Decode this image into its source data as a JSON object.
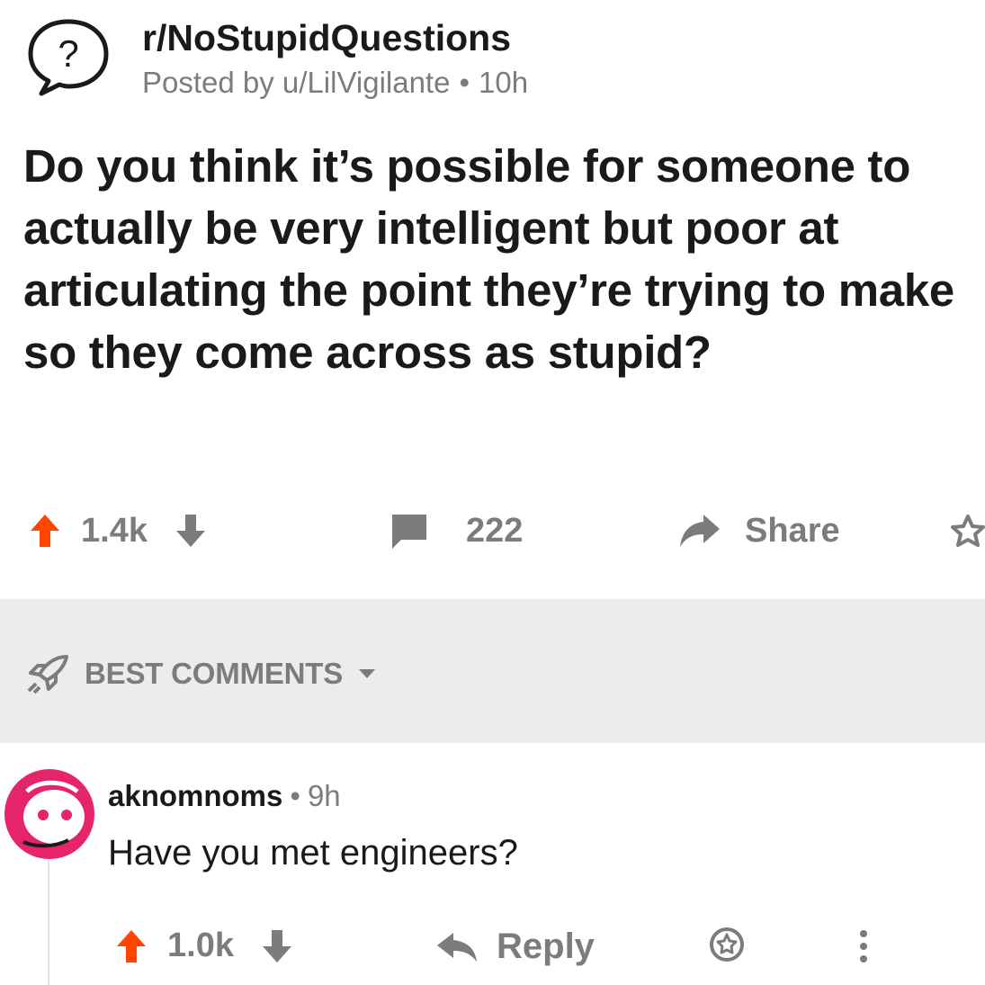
{
  "header": {
    "subreddit": "r/NoStupidQuestions",
    "posted_by": "Posted by u/LilVigilante",
    "dot": "•",
    "age": "10h"
  },
  "post": {
    "title": "Do you think it’s possible for someone to actually be very intelligent but poor at articulating the point they’re trying to make so they come across as stupid?"
  },
  "post_actions": {
    "votes": "1.4k",
    "comments": "222",
    "share_label": "Share"
  },
  "sort": {
    "label": "BEST COMMENTS"
  },
  "comment": {
    "author": "aknomnoms",
    "dot": "•",
    "age": "9h",
    "body": "Have you met engineers?",
    "votes": "1.0k",
    "reply_label": "Reply"
  },
  "colors": {
    "upvote": "#ff4500",
    "muted": "#7c7c7c",
    "text": "#1a1a1b",
    "band": "#ececec",
    "avatar": "#e5246b"
  },
  "icons": {
    "subreddit": "question-bubble-icon",
    "upvote": "upvote-arrow-icon",
    "downvote": "downvote-arrow-icon",
    "comment": "comment-bubble-icon",
    "share": "share-arrow-icon",
    "award": "award-icon",
    "sort": "rocket-icon",
    "caret": "caret-down-icon",
    "reply": "reply-arrow-icon",
    "more": "more-vertical-icon"
  }
}
